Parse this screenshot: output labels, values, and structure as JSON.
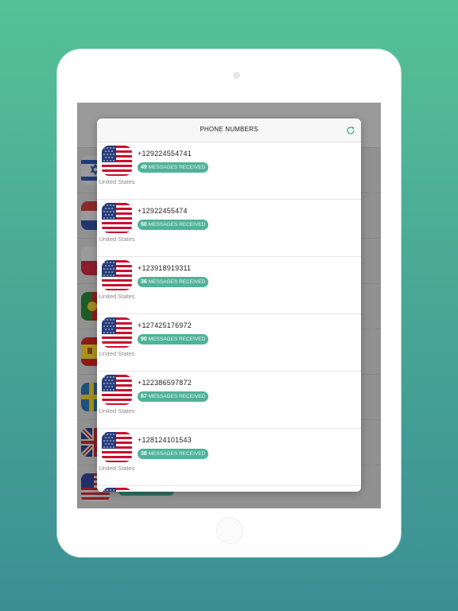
{
  "modal": {
    "title": "PHONE NUMBERS",
    "refresh_icon": "refresh-icon"
  },
  "numbers": [
    {
      "country": "United States",
      "number": "+12922455474​1",
      "count": "49",
      "label": "MESSAGES RECEIVED"
    },
    {
      "country": "United States",
      "number": "+12922455474",
      "count": "50",
      "label": "MESSAGES RECEIVED"
    },
    {
      "country": "United States",
      "number": "+123918919311",
      "count": "36",
      "label": "MESSAGES RECEIVED"
    },
    {
      "country": "United States",
      "number": "+127425176972",
      "count": "90",
      "label": "MESSAGES RECEIVED"
    },
    {
      "country": "United States",
      "number": "+122386597872",
      "count": "67",
      "label": "MESSAGES RECEIVED"
    },
    {
      "country": "United States",
      "number": "+128124101543",
      "count": "38",
      "label": "MESSAGES RECEIVED"
    }
  ],
  "colors": {
    "accent": "#4fb398",
    "background_top": "#56c197",
    "background_bottom": "#3c8f93"
  }
}
